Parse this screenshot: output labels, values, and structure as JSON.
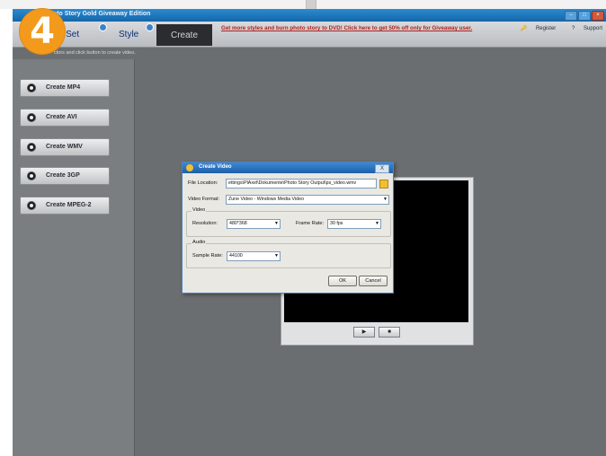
{
  "window": {
    "title": "Photo Story Gold Giveaway Edition"
  },
  "step_badge": "4",
  "toolbar": {
    "tab_photo": "to Set",
    "tab_style": "Style",
    "tab_create": "Create",
    "promo": "Get more styles and burn photo story to DVD! Click here to get 50% off only for Giveaway user.",
    "register": "Register",
    "support": "Support"
  },
  "hint": "ctors and click button to create video.",
  "sidebar": {
    "buttons": [
      "Create MP4",
      "Create AVI",
      "Create WMV",
      "Create 3GP",
      "Create MPEG-2"
    ]
  },
  "preview": {
    "play_icon": "play-icon",
    "stop_icon": "stop-icon",
    "play": "▶",
    "stop": "■"
  },
  "dialog": {
    "title": "Create Video",
    "close": "X",
    "file_location_label": "File Location:",
    "file_location_value": "ettings\\PlAxel\\Dokumente\\Photo Story Output\\ps_video.wmv",
    "video_format_label": "Video Format:",
    "video_format_value": "Zune Video - Windows Media Video",
    "video_group": "Video",
    "resolution_label": "Resolution:",
    "resolution_value": "480*368",
    "frame_rate_label": "Frame Rate:",
    "frame_rate_value": "30 fps",
    "audio_group": "Audio",
    "sample_rate_label": "Sample Rate:",
    "sample_rate_value": "44100",
    "ok": "OK",
    "cancel": "Cancel"
  },
  "colors": {
    "titlebar": "#1f73bd",
    "workspace": "#6b6e71",
    "badge": "#f39a1c",
    "promo": "#b3201b"
  }
}
